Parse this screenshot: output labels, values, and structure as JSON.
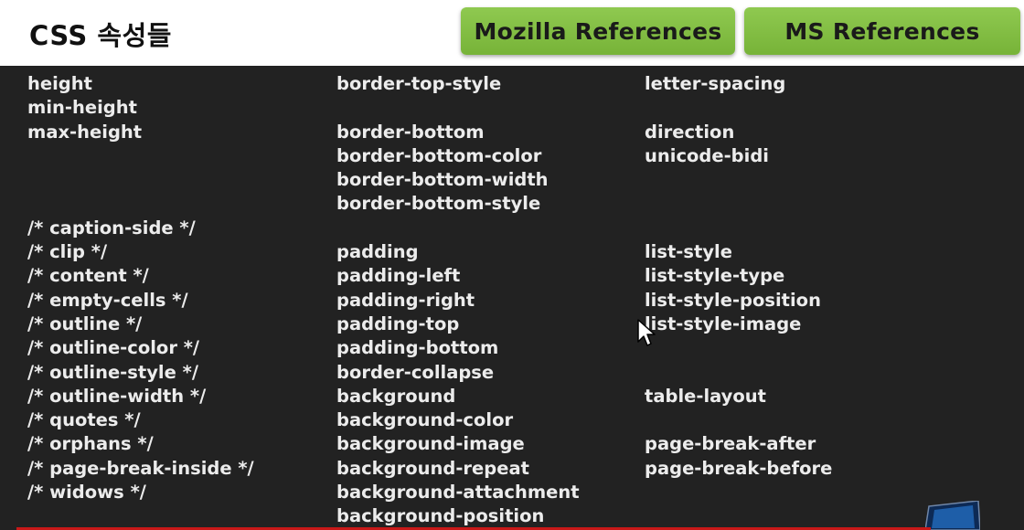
{
  "header": {
    "title": "CSS 속성들",
    "mozilla_button": "Mozilla References",
    "ms_button": "MS References"
  },
  "columns": [
    {
      "items": [
        "height",
        "min-height",
        "max-height",
        "",
        "",
        "",
        "/* caption-side */",
        "/* clip */",
        "/* content */",
        "/* empty-cells */",
        "/* outline */",
        "/* outline-color */",
        "/* outline-style */",
        "/* outline-width */",
        "/* quotes */",
        "/* orphans */",
        "/* page-break-inside */",
        "/* widows */"
      ]
    },
    {
      "items": [
        "border-top-style",
        "",
        "border-bottom",
        "border-bottom-color",
        "border-bottom-width",
        "border-bottom-style",
        "",
        "padding",
        "padding-left",
        "padding-right",
        "padding-top",
        "padding-bottom",
        "border-collapse",
        "background",
        "background-color",
        "background-image",
        "background-repeat",
        "background-attachment",
        "background-position"
      ]
    },
    {
      "items": [
        "letter-spacing",
        "",
        "direction",
        "unicode-bidi",
        "",
        "",
        "",
        "list-style",
        "list-style-type",
        "list-style-position",
        "list-style-image",
        "",
        "",
        "table-layout",
        "",
        "page-break-after",
        "page-break-before"
      ]
    }
  ],
  "colors": {
    "button_green": "#82be43",
    "background": "#222222",
    "text": "#ececec"
  },
  "icons": [
    "mouse-cursor-icon"
  ]
}
